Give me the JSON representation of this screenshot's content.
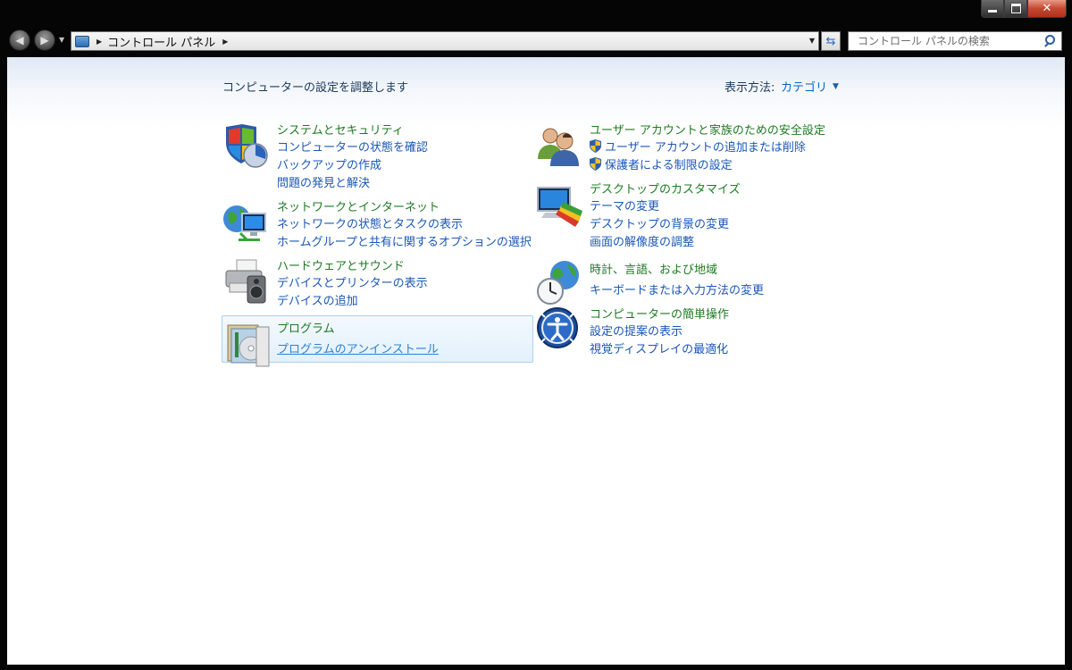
{
  "window": {
    "caption_buttons": [
      "minimize",
      "maximize",
      "close"
    ]
  },
  "address_bar": {
    "breadcrumb": "コントロール パネル",
    "icon": "control-panel-icon"
  },
  "search": {
    "placeholder": "コントロール パネルの検索"
  },
  "header": {
    "title": "コンピューターの設定を調整します",
    "view_by_label": "表示方法:",
    "view_by_value": "カテゴリ"
  },
  "categories_left": [
    {
      "heading": "システムとセキュリティ",
      "icon": "security-shield-icon",
      "links": [
        "コンピューターの状態を確認",
        "バックアップの作成",
        "問題の発見と解決"
      ]
    },
    {
      "heading": "ネットワークとインターネット",
      "icon": "network-globe-icon",
      "links": [
        "ネットワークの状態とタスクの表示",
        "ホームグループと共有に関するオプションの選択"
      ]
    },
    {
      "heading": "ハードウェアとサウンド",
      "icon": "printer-speaker-icon",
      "links": [
        "デバイスとプリンターの表示",
        "デバイスの追加"
      ]
    },
    {
      "heading": "プログラム",
      "icon": "programs-disc-icon",
      "links": [
        "プログラムのアンインストール"
      ]
    }
  ],
  "categories_right": [
    {
      "heading": "ユーザー アカウントと家族のための安全設定",
      "icon": "users-icon",
      "links": [
        "ユーザー アカウントの追加または削除",
        "保護者による制限の設定"
      ]
    },
    {
      "heading": "デスクトップのカスタマイズ",
      "icon": "desktop-monitor-icon",
      "links": [
        "テーマの変更",
        "デスクトップの背景の変更",
        "画面の解像度の調整"
      ]
    },
    {
      "heading": "時計、言語、および地域",
      "icon": "clock-globe-icon",
      "links": [
        "キーボードまたは入力方法の変更"
      ]
    },
    {
      "heading": "コンピューターの簡単操作",
      "icon": "ease-of-access-icon",
      "links": [
        "設定の提案の表示",
        "視覚ディスプレイの最適化"
      ]
    }
  ],
  "colors": {
    "heading": "#1d7a23",
    "link": "#1a57b8",
    "title": "#1e395b",
    "frame": "#050505"
  }
}
